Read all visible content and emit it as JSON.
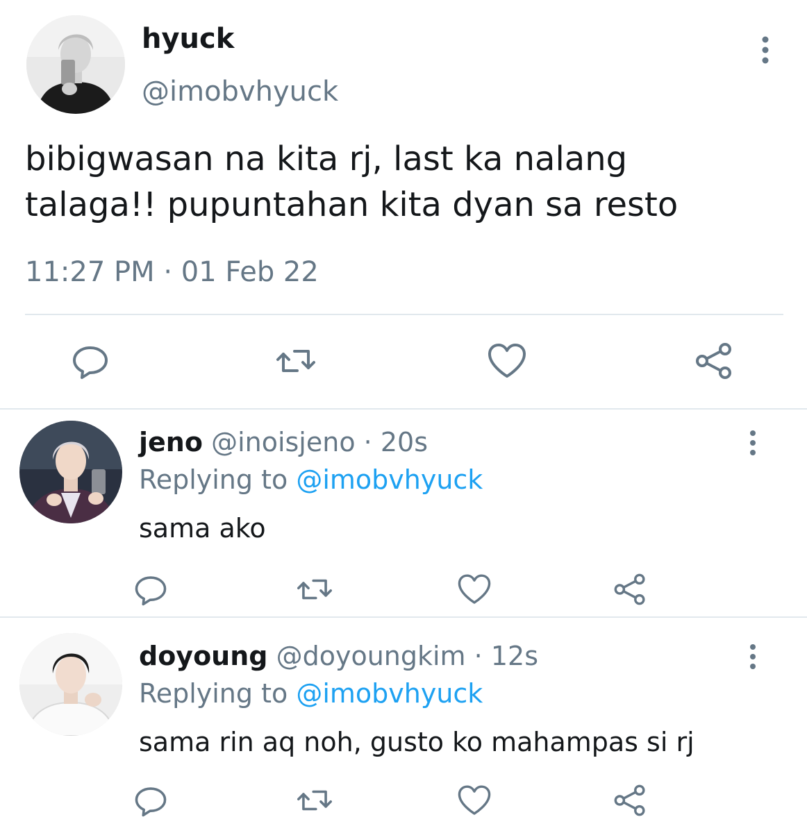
{
  "main_tweet": {
    "display_name": "hyuck",
    "handle": "@imobvhyuck",
    "text": "bibigwasan na kita rj, last ka nalang\ntalaga!! pupuntahan kita dyan sa resto",
    "time": "11:27 PM",
    "separator": "·",
    "date": "01 Feb 22"
  },
  "replies": [
    {
      "display_name": "jeno",
      "handle": "@inoisjeno",
      "separator": "·",
      "age": "20s",
      "replying_label": "Replying to",
      "replying_handle": "@imobvhyuck",
      "text": "sama ako"
    },
    {
      "display_name": "doyoung",
      "handle": "@doyoungkim",
      "separator": "·",
      "age": "12s",
      "replying_label": "Replying to",
      "replying_handle": "@imobvhyuck",
      "text": "sama rin aq noh, gusto ko mahampas si rj"
    }
  ],
  "icons": {
    "reply": "reply-icon",
    "retweet": "retweet-icon",
    "like": "heart-icon",
    "share": "share-icon",
    "more": "more-vertical-icon"
  },
  "colors": {
    "text_primary": "#14171a",
    "text_secondary": "#657786",
    "link": "#1da1f2",
    "divider": "#e1e8ed"
  }
}
